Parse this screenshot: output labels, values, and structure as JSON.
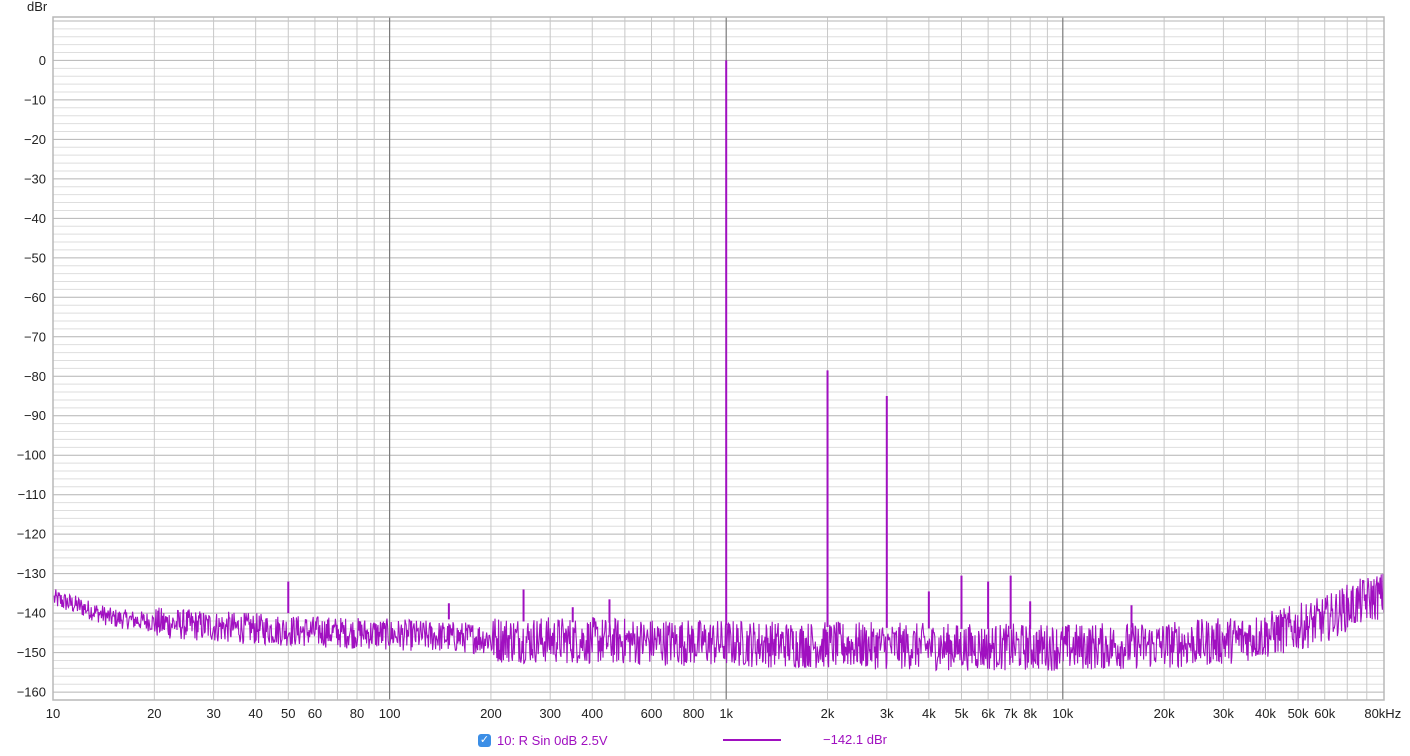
{
  "chart_data": {
    "type": "line",
    "title": "",
    "ylabel": "dBr",
    "xlabel": "",
    "xscale": "log",
    "xlim": [
      10,
      90000
    ],
    "ylim": [
      -162,
      11
    ],
    "grid": true,
    "yticks": [
      0,
      -10,
      -20,
      -30,
      -40,
      -50,
      -60,
      -70,
      -80,
      -90,
      -100,
      -110,
      -120,
      -130,
      -140,
      -150,
      -160
    ],
    "xticks": [
      {
        "value": 10,
        "label": "10"
      },
      {
        "value": 20,
        "label": "20"
      },
      {
        "value": 30,
        "label": "30"
      },
      {
        "value": 40,
        "label": "40"
      },
      {
        "value": 50,
        "label": "50"
      },
      {
        "value": 60,
        "label": "60"
      },
      {
        "value": 80,
        "label": "80"
      },
      {
        "value": 100,
        "label": "100"
      },
      {
        "value": 200,
        "label": "200"
      },
      {
        "value": 300,
        "label": "300"
      },
      {
        "value": 400,
        "label": "400"
      },
      {
        "value": 600,
        "label": "600"
      },
      {
        "value": 800,
        "label": "800"
      },
      {
        "value": 1000,
        "label": "1k"
      },
      {
        "value": 2000,
        "label": "2k"
      },
      {
        "value": 3000,
        "label": "3k"
      },
      {
        "value": 4000,
        "label": "4k"
      },
      {
        "value": 5000,
        "label": "5k"
      },
      {
        "value": 6000,
        "label": "6k"
      },
      {
        "value": 7000,
        "label": "7k"
      },
      {
        "value": 8000,
        "label": "8k"
      },
      {
        "value": 10000,
        "label": "10k"
      },
      {
        "value": 20000,
        "label": "20k"
      },
      {
        "value": 30000,
        "label": "30k"
      },
      {
        "value": 40000,
        "label": "40k"
      },
      {
        "value": 50000,
        "label": "50k"
      },
      {
        "value": 60000,
        "label": "60k"
      },
      {
        "value": 80000,
        "label": "80kHz"
      }
    ],
    "series": [
      {
        "name": "10: R Sin 0dB 2.5V",
        "color": "#a010c0",
        "readout": "-142.1 dBr",
        "noise_floor": [
          [
            10,
            -136
          ],
          [
            12,
            -138
          ],
          [
            15,
            -141
          ],
          [
            20,
            -142
          ],
          [
            30,
            -143
          ],
          [
            50,
            -144
          ],
          [
            100,
            -145
          ],
          [
            200,
            -146
          ],
          [
            500,
            -146.5
          ],
          [
            1000,
            -147
          ],
          [
            2000,
            -147.5
          ],
          [
            5000,
            -148
          ],
          [
            10000,
            -148
          ],
          [
            20000,
            -147.5
          ],
          [
            30000,
            -146.5
          ],
          [
            40000,
            -145
          ],
          [
            50000,
            -143
          ],
          [
            60000,
            -141
          ],
          [
            70000,
            -138
          ],
          [
            80000,
            -136
          ],
          [
            88000,
            -135
          ]
        ],
        "peaks": [
          [
            50,
            -132
          ],
          [
            150,
            -137.5
          ],
          [
            250,
            -134
          ],
          [
            350,
            -138.5
          ],
          [
            450,
            -136.5
          ],
          [
            1000,
            0
          ],
          [
            2000,
            -78.5
          ],
          [
            3000,
            -85
          ],
          [
            4000,
            -134.5
          ],
          [
            5000,
            -130.5
          ],
          [
            6000,
            -132
          ],
          [
            7000,
            -130.5
          ],
          [
            8000,
            -137
          ],
          [
            16000,
            -138
          ]
        ]
      }
    ]
  },
  "legend": {
    "checked": "✓",
    "name": "10: R Sin 0dB 2.5V",
    "value": "−142.1 dBr"
  }
}
